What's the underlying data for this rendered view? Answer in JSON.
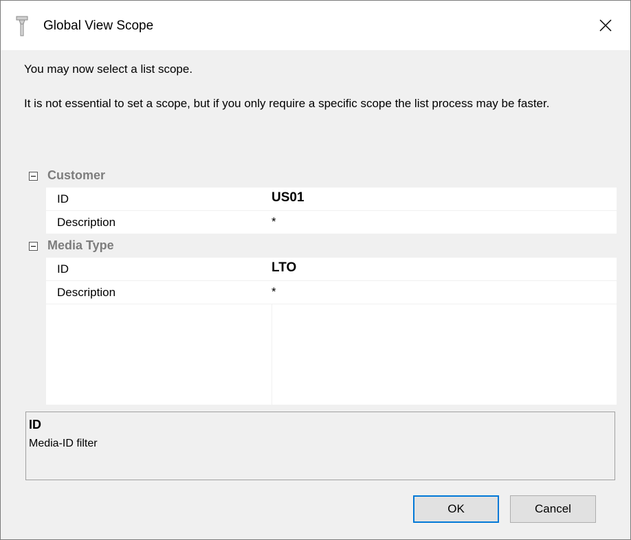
{
  "window": {
    "title": "Global View Scope"
  },
  "intro_text": "You may now select a list scope.",
  "info_text": "It is not essential to set a scope, but if you only require a specific scope the list process may be faster.",
  "property_grid": {
    "categories": [
      {
        "label": "Customer",
        "rows": [
          {
            "name": "ID",
            "value": "US01",
            "bold": true
          },
          {
            "name": "Description",
            "value": "*",
            "bold": false
          }
        ]
      },
      {
        "label": "Media Type",
        "rows": [
          {
            "name": "ID",
            "value": "LTO",
            "bold": true
          },
          {
            "name": "Description",
            "value": "*",
            "bold": false
          }
        ]
      }
    ]
  },
  "description_pane": {
    "title": "ID",
    "text": "Media-ID filter"
  },
  "buttons": {
    "ok_label": "OK",
    "cancel_label": "Cancel"
  },
  "colors": {
    "accent": "#0078d7",
    "category_text": "#7d7d7d",
    "dialog_background": "#f0f0f0"
  },
  "icons": {
    "title_icon": "tape-funnel-icon",
    "close_icon": "close-icon",
    "collapse_icon": "minus-box-icon"
  }
}
